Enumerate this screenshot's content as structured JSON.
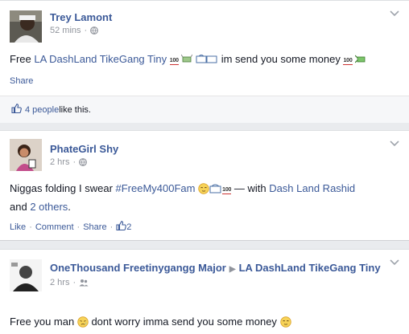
{
  "posts": [
    {
      "author": "Trey Lamont",
      "time": "52 mins",
      "text_pre": "Free ",
      "link1": "LA DashLand TikeGang Tiny",
      "text_mid": " im send you some money ",
      "hundred": "100",
      "share": "Share",
      "likes_count": "4 people",
      "likes_suffix": " like this."
    },
    {
      "author": "PhateGirl Shy",
      "time": "2 hrs",
      "text_pre": "Niggas folding I swear ",
      "hashtag": "#FreeMy400Fam",
      "hundred": "100",
      "with_text": " — with ",
      "tagged": "Dash Land Rashid",
      "and_text": "and ",
      "others": "2 others",
      "period": ".",
      "like": "Like",
      "comment": "Comment",
      "share": "Share",
      "like_count": "2"
    },
    {
      "author": "OneThousand Freetinygangg Major",
      "target": "LA DashLand TikeGang Tiny",
      "time": "2 hrs",
      "text_pre": "Free you man ",
      "text_mid": " dont worry imma send you some money "
    }
  ],
  "separator": "·",
  "colors": {
    "link": "#3b5998",
    "meta": "#90949c",
    "background": "#e9ebee"
  },
  "icons": [
    "globe-icon",
    "friends-icon",
    "thumbs-up-icon",
    "chevron-down-icon",
    "hundred-emoji",
    "money-wings-emoji",
    "dollar-bills-emoji",
    "relieved-face-emoji",
    "disappointed-face-emoji"
  ]
}
